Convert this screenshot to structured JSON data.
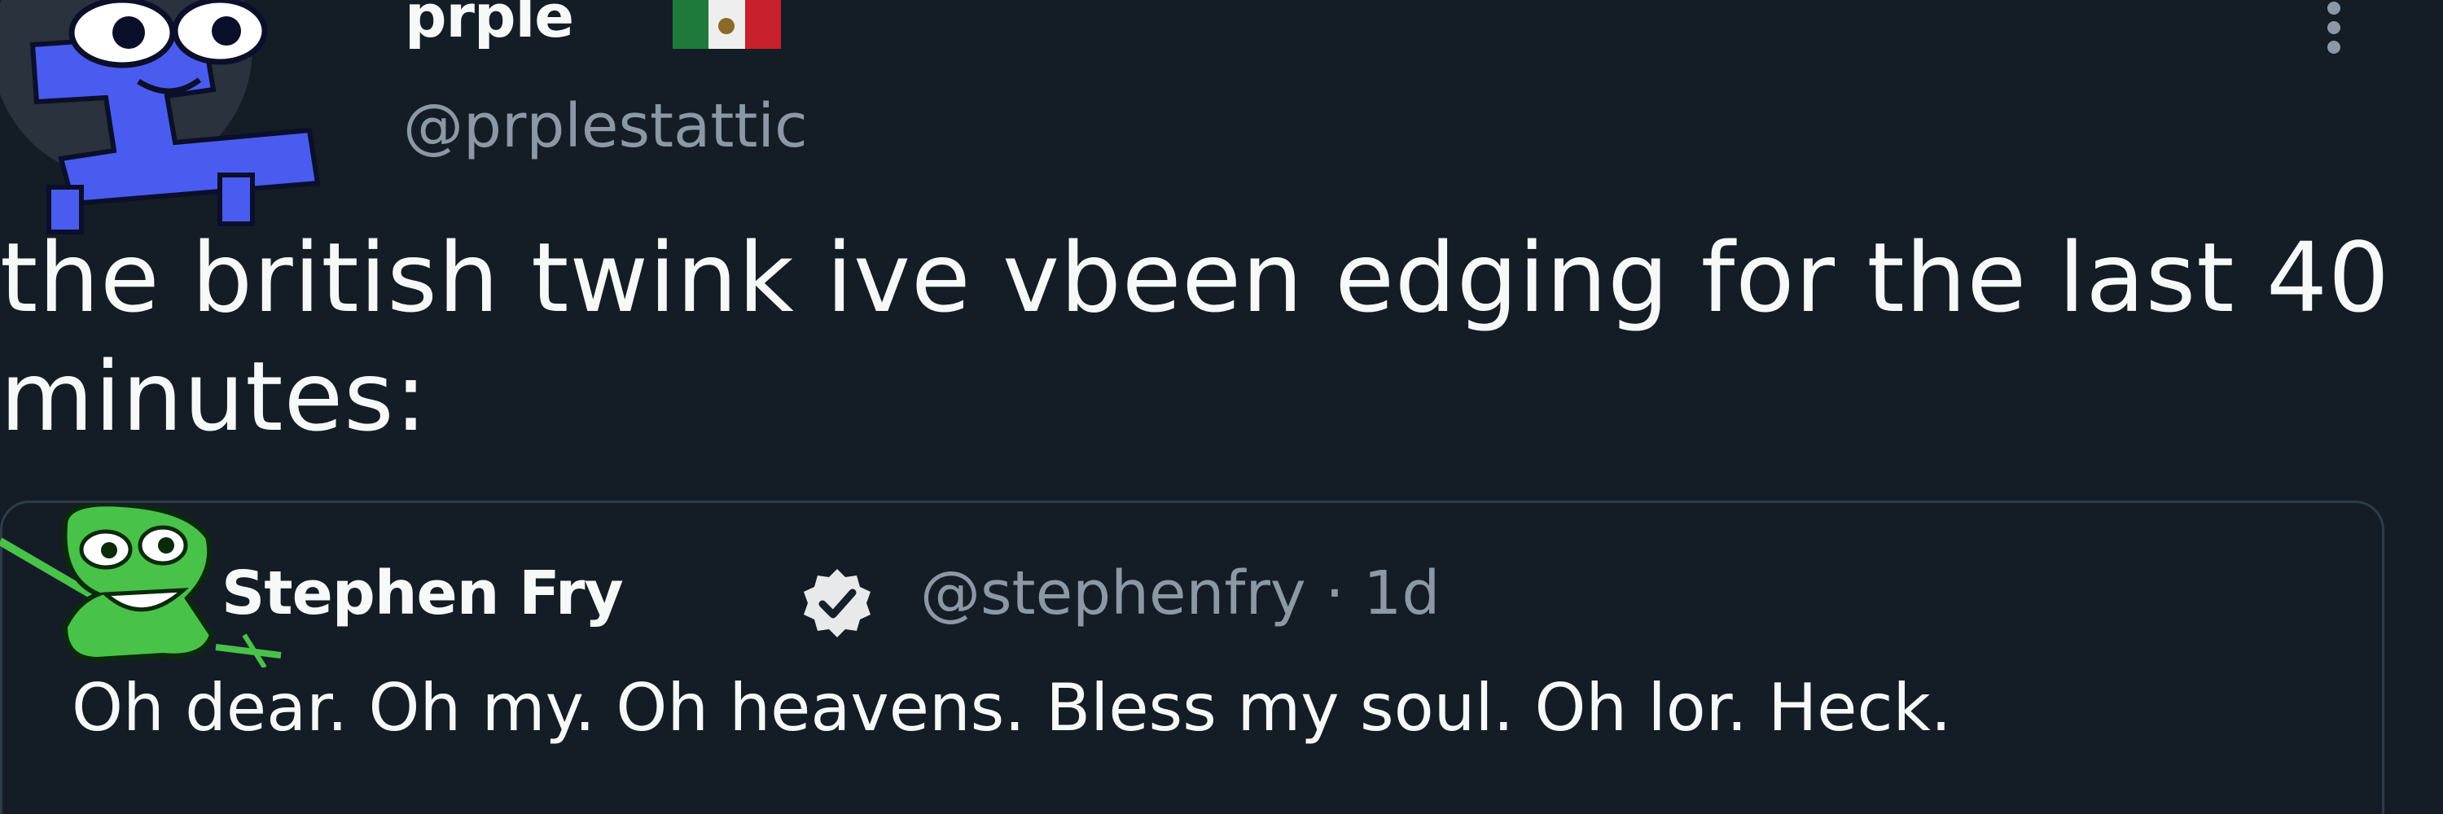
{
  "tweet": {
    "display_name": "prple",
    "handle": "@prplestattic",
    "flag_icon": "mexico-flag-icon",
    "more_icon": "more-vertical-icon",
    "text": "the british twink ive vbeen edging for the last 40 minutes:"
  },
  "quote": {
    "display_name": "Stephen Fry",
    "verified_icon": "verified-badge-icon",
    "handle": "@stephenfry",
    "separator": "·",
    "time": "1d",
    "text": "Oh dear. Oh my. Oh heavens. Bless my soul. Oh lor. Heck."
  },
  "colors": {
    "background": "#15202b",
    "primary_text": "#f7f9f9",
    "secondary_text": "#8b98a5",
    "border": "#2f3c47",
    "avatar_blue": "#4a5cf0",
    "avatar_green": "#49c24a"
  }
}
